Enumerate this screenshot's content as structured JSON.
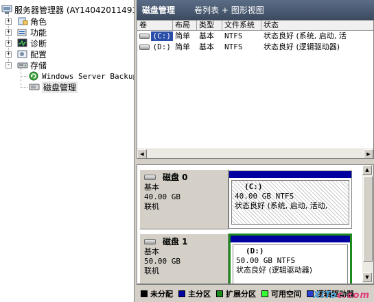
{
  "tree": {
    "root": "服务器管理器 (AY140420114933",
    "items": [
      {
        "label": "角色",
        "icon": "roles-icon",
        "expander": "+"
      },
      {
        "label": "功能",
        "icon": "features-icon",
        "expander": "+"
      },
      {
        "label": "诊断",
        "icon": "diagnostics-icon",
        "expander": "+"
      },
      {
        "label": "配置",
        "icon": "configuration-icon",
        "expander": "+"
      },
      {
        "label": "存储",
        "icon": "storage-icon",
        "expander": "-"
      }
    ],
    "storage_children": [
      {
        "label": "Windows Server Backup",
        "icon": "backup-icon"
      },
      {
        "label": "磁盘管理",
        "icon": "disk-management-icon",
        "selected": true
      }
    ]
  },
  "header": {
    "title": "磁盘管理",
    "view": "卷列表 + 图形视图"
  },
  "volume_table": {
    "columns": [
      "卷",
      "布局",
      "类型",
      "文件系统",
      "状态"
    ],
    "rows": [
      {
        "volume": "(C:)",
        "layout": "简单",
        "type": "基本",
        "fs": "NTFS",
        "status": "状态良好 (系统, 启动, 活"
      },
      {
        "volume": "(D:)",
        "layout": "简单",
        "type": "基本",
        "fs": "NTFS",
        "status": "状态良好 (逻辑驱动器)"
      }
    ]
  },
  "disks": [
    {
      "name": "磁盘 0",
      "kind": "基本",
      "size": "40.00 GB",
      "state": "联机",
      "partition": {
        "name": "(C:)",
        "detail": "40.00 GB NTFS",
        "status": "状态良好 (系统, 启动, 活动,"
      }
    },
    {
      "name": "磁盘 1",
      "kind": "基本",
      "size": "50.00 GB",
      "state": "联机",
      "partition": {
        "name": "(D:)",
        "detail": "50.00 GB NTFS",
        "status": "状态良好 (逻辑驱动器)"
      }
    }
  ],
  "legend": [
    {
      "label": "未分配",
      "color": "#000000"
    },
    {
      "label": "主分区",
      "color": "#0000a0"
    },
    {
      "label": "扩展分区",
      "color": "#1c8a1c"
    },
    {
      "label": "可用空间",
      "color": "#33ff33"
    },
    {
      "label": "逻辑驱动器",
      "color": "#2a3fd0"
    }
  ],
  "watermark": {
    "part1": "XiTo",
    "part2": "c.com"
  },
  "colors": {
    "primary_partition": "#0000a0",
    "selection_blue": "#2b4fa8",
    "extended_green": "#1c8a1c"
  }
}
